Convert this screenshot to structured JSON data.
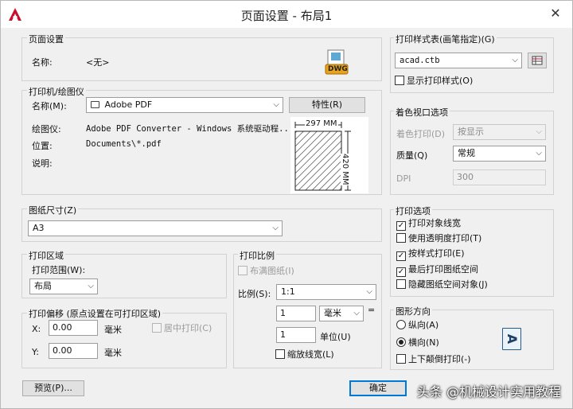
{
  "window": {
    "title": "页面设置 - 布局1",
    "close_glyph": "✕"
  },
  "page_setup": {
    "title": "页面设置",
    "name_label": "名称:",
    "name_value": "<无>",
    "dwg_badge": "DWG"
  },
  "printer": {
    "title": "打印机/绘图仪",
    "name_label": "名称(M):",
    "name_value": "Adobe PDF",
    "properties_button": "特性(R)",
    "plotter_label": "绘图仪:",
    "plotter_value": "Adobe PDF Converter - Windows 系统驱动程...",
    "location_label": "位置:",
    "location_value": "Documents\\*.pdf",
    "description_label": "说明:",
    "preview_width": "297 MM",
    "preview_height": "420 MM"
  },
  "paper_size": {
    "title": "图纸尺寸(Z)",
    "value": "A3"
  },
  "plot_area": {
    "title": "打印区域",
    "range_label": "打印范围(W):",
    "range_value": "布局"
  },
  "plot_offset": {
    "title": "打印偏移 (原点设置在可打印区域)",
    "x_label": "X:",
    "x_value": "0.00",
    "x_unit": "毫米",
    "y_label": "Y:",
    "y_value": "0.00",
    "y_unit": "毫米",
    "center_label": "居中打印(C)"
  },
  "plot_scale": {
    "title": "打印比例",
    "fit_label": "布满图纸(I)",
    "scale_label": "比例(S):",
    "scale_value": "1:1",
    "value1": "1",
    "unit1": "毫米",
    "equals": "=",
    "value2": "1",
    "unit2": "单位(U)",
    "scale_lineweights": "缩放线宽(L)"
  },
  "plot_style_table": {
    "title": "打印样式表(画笔指定)(G)",
    "value": "acad.ctb",
    "display_label": "显示打印样式(O)"
  },
  "shaded_viewport": {
    "title": "着色视口选项",
    "shade_label": "着色打印(D)",
    "shade_value": "按显示",
    "quality_label": "质量(Q)",
    "quality_value": "常规",
    "dpi_label": "DPI",
    "dpi_value": "300"
  },
  "plot_options": {
    "title": "打印选项",
    "items": [
      {
        "label": "打印对象线宽",
        "checked": true
      },
      {
        "label": "使用透明度打印(T)",
        "checked": false
      },
      {
        "label": "按样式打印(E)",
        "checked": true
      },
      {
        "label": "最后打印图纸空间",
        "checked": true
      },
      {
        "label": "隐藏图纸空间对象(J)",
        "checked": false
      }
    ]
  },
  "drawing_orientation": {
    "title": "图形方向",
    "portrait": "纵向(A)",
    "landscape": "横向(N)",
    "upside_down": "上下颠倒打印(-)",
    "orientation_glyph": "A"
  },
  "footer": {
    "preview_button": "预览(P)...",
    "ok_button": "确定"
  },
  "watermark": "头条 @机械设计实用教程",
  "colors": {
    "accent": "#0078d7",
    "autocad_red": "#c8102e",
    "group_border": "#d2d2d2"
  }
}
